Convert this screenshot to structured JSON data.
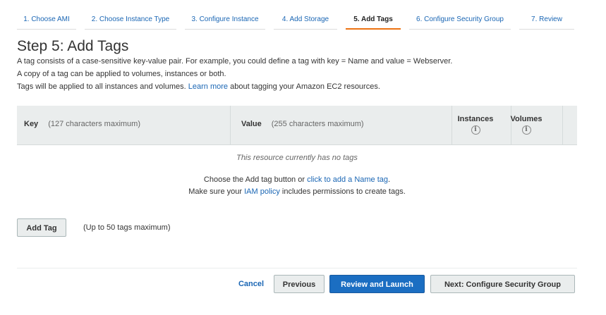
{
  "wizard": {
    "steps": [
      {
        "label": "1. Choose AMI"
      },
      {
        "label": "2. Choose Instance Type"
      },
      {
        "label": "3. Configure Instance"
      },
      {
        "label": "4. Add Storage"
      },
      {
        "label": "5. Add Tags"
      },
      {
        "label": "6. Configure Security Group"
      },
      {
        "label": "7. Review"
      }
    ],
    "active_step": "5. Add Tags"
  },
  "page": {
    "title": "Step 5: Add Tags",
    "line1": "A tag consists of a case-sensitive key-value pair. For example, you could define a tag with key = Name and value = Webserver.",
    "line2": "A copy of a tag can be applied to volumes, instances or both.",
    "line3_prefix": "Tags will be applied to all instances and volumes.",
    "line3_link": "Learn more",
    "line3_suffix": "about tagging your Amazon EC2 resources."
  },
  "table": {
    "key_header": "Key",
    "key_hint": "(127 characters maximum)",
    "value_header": "Value",
    "value_hint": "(255 characters maximum)",
    "instances_header": "Instances",
    "volumes_header": "Volumes",
    "info_glyph": "i"
  },
  "empty_state": {
    "no_tags": "This resource currently has no tags",
    "choose_prefix": "Choose the Add tag button or",
    "choose_link": "click to add a Name tag",
    "choose_suffix": ".",
    "iam_prefix": "Make sure your",
    "iam_link": "IAM policy",
    "iam_suffix": "includes permissions to create tags."
  },
  "add_tag": {
    "button": "Add Tag",
    "hint": "(Up to 50 tags maximum)"
  },
  "footer": {
    "cancel": "Cancel",
    "previous": "Previous",
    "review_launch": "Review and Launch",
    "next": "Next: Configure Security Group"
  },
  "colors": {
    "accent_orange": "#ec7211",
    "link_blue": "#1a66b4",
    "primary_button": "#1b6ec2",
    "header_bg": "#eaeded"
  }
}
